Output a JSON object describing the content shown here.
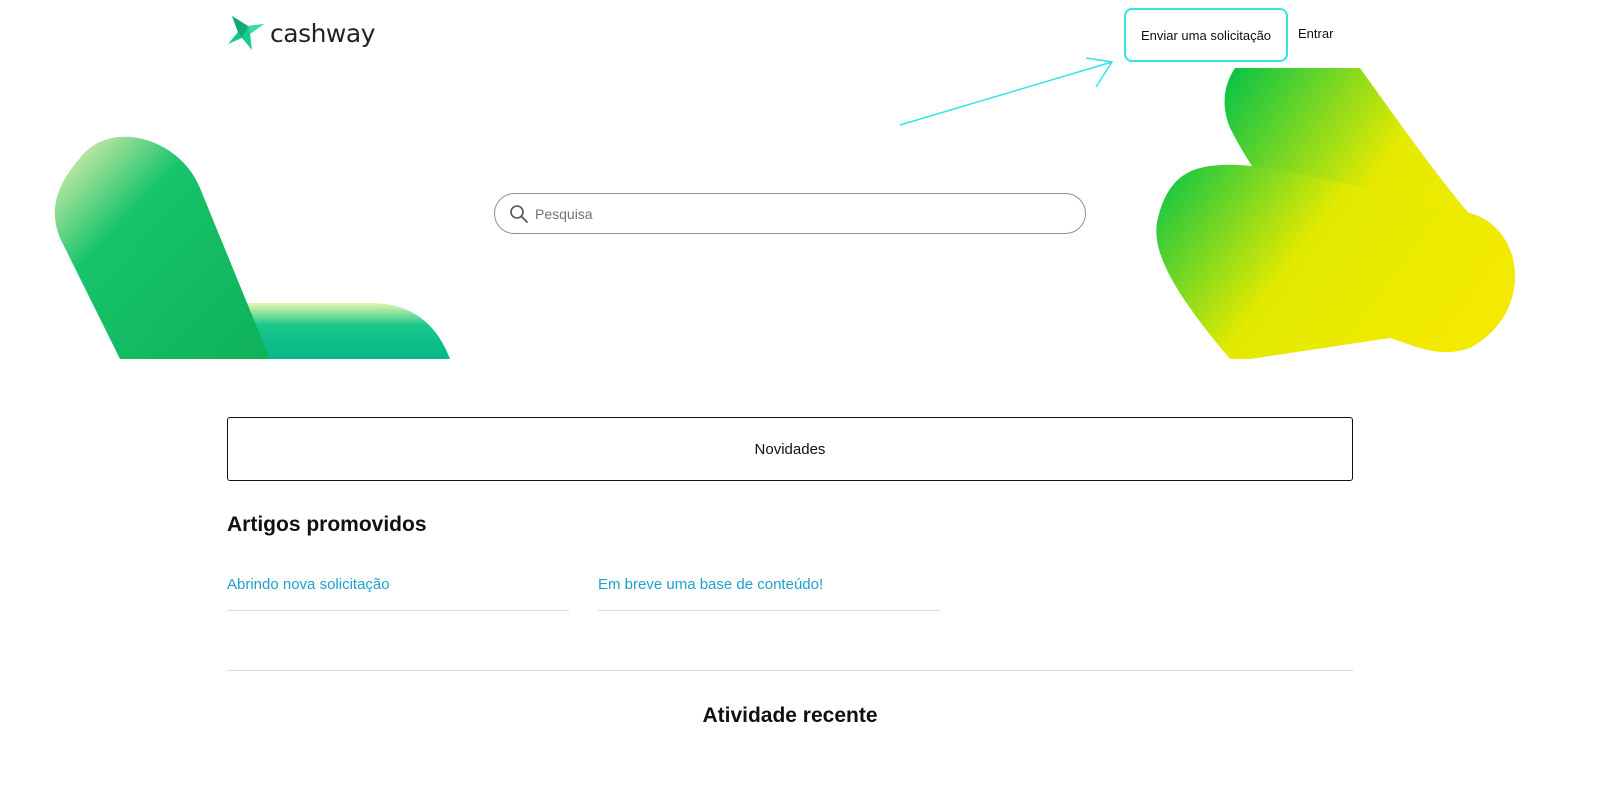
{
  "header": {
    "brand_name": "cashway",
    "logo_icon": "cashway-star-logo-icon",
    "submit_request_label": "Enviar uma solicitação",
    "sign_in_label": "Entrar"
  },
  "search": {
    "placeholder": "Pesquisa",
    "icon": "search-icon"
  },
  "news_button_label": "Novidades",
  "promoted_articles": {
    "title": "Artigos promovidos",
    "items": [
      {
        "label": "Abrindo nova solicitação"
      },
      {
        "label": "Em breve uma base de conteúdo!"
      }
    ]
  },
  "recent_activity": {
    "title": "Atividade recente"
  },
  "colors": {
    "brand_green": "#1cc98a",
    "link": "#1f9fcf",
    "highlight": "#2fe5e8",
    "hero_yellow": "#f2ea00",
    "hero_green": "#00c24a"
  }
}
